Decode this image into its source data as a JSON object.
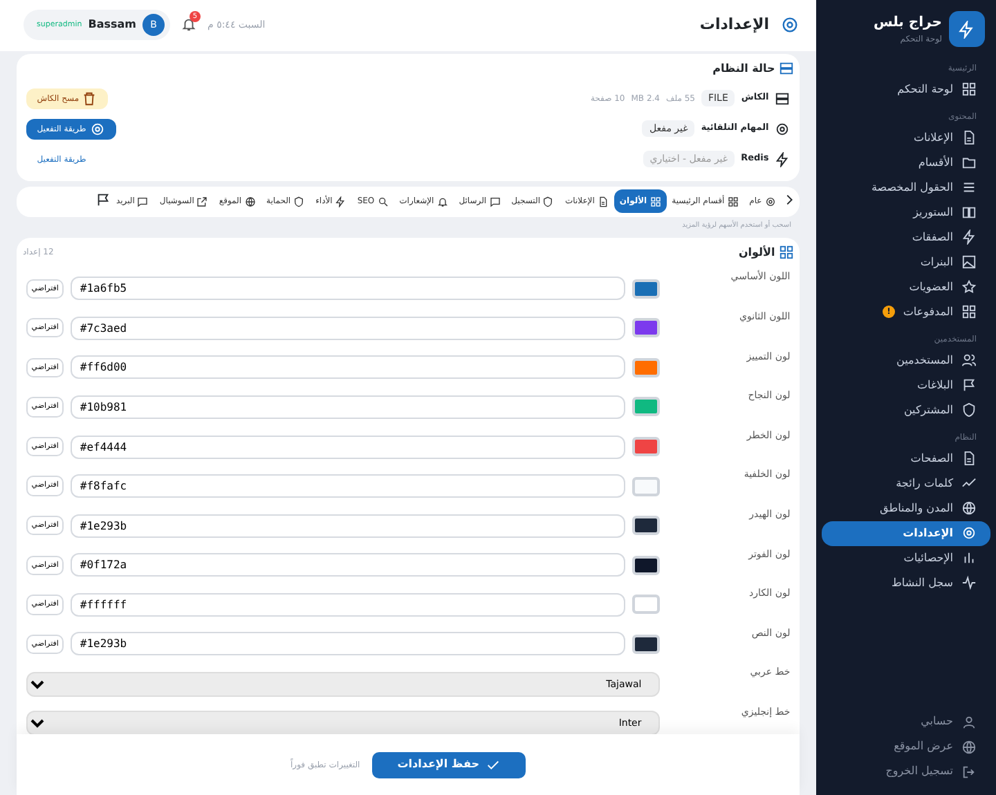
{
  "header": {
    "title": "الإعدادات",
    "datetime": "السبت ٥:٤٤ م",
    "notifications": "5",
    "user": {
      "initial": "B",
      "name": "Bassam",
      "role": "superadmin"
    }
  },
  "status": {
    "title": "حالة النظام",
    "rows": [
      {
        "kind": "cache",
        "label": "الكاش",
        "badge": "FILE",
        "stats": [
          "55 ملف",
          "2.4 MB",
          "10 صفحة"
        ],
        "action": {
          "kind": "warning",
          "label": "مسح الكاش"
        }
      },
      {
        "kind": "cron",
        "label": "المهام التلقائية",
        "badge": "غير مفعل",
        "stats": [],
        "action": {
          "kind": "primary",
          "label": "طريقة التفعيل"
        }
      },
      {
        "kind": "redis",
        "label": "Redis",
        "badge": "غير مفعل - اختياري",
        "stats": [],
        "action": {
          "kind": "link",
          "label": "طريقة التفعيل"
        }
      }
    ]
  },
  "tabs": [
    {
      "label": "عام",
      "selected": false
    },
    {
      "label": "أقسام الرئيسية",
      "selected": false
    },
    {
      "label": "الألوان",
      "selected": true
    },
    {
      "label": "الإعلانات",
      "selected": false
    },
    {
      "label": "التسجيل",
      "selected": false
    },
    {
      "label": "الرسائل",
      "selected": false
    },
    {
      "label": "الإشعارات",
      "selected": false
    },
    {
      "label": "SEO",
      "selected": false
    },
    {
      "label": "الأداء",
      "selected": false
    },
    {
      "label": "الحماية",
      "selected": false
    },
    {
      "label": "الموقع",
      "selected": false
    },
    {
      "label": "السوشيال",
      "selected": false
    },
    {
      "label": "البريد",
      "selected": false
    }
  ],
  "tabs_hint": "اسحب أو استخدم الأسهم لرؤية المزيد",
  "colors": {
    "title": "الألوان",
    "count": "12 إعداد",
    "fields": [
      {
        "kind": "color",
        "label": "اللون الأساسي",
        "value": "#1a6fb5",
        "reset": "افتراضي"
      },
      {
        "kind": "color",
        "label": "اللون الثانوي",
        "value": "#7c3aed",
        "reset": "افتراضي"
      },
      {
        "kind": "color",
        "label": "لون التمييز",
        "value": "#ff6d00",
        "reset": "افتراضي"
      },
      {
        "kind": "color",
        "label": "لون النجاح",
        "value": "#10b981",
        "reset": "افتراضي"
      },
      {
        "kind": "color",
        "label": "لون الخطر",
        "value": "#ef4444",
        "reset": "افتراضي"
      },
      {
        "kind": "color",
        "label": "لون الخلفية",
        "value": "#f8fafc",
        "reset": "افتراضي"
      },
      {
        "kind": "color",
        "label": "لون الهيدر",
        "value": "#1e293b",
        "reset": "افتراضي"
      },
      {
        "kind": "color",
        "label": "لون الفوتر",
        "value": "#0f172a",
        "reset": "افتراضي"
      },
      {
        "kind": "color",
        "label": "لون الكارد",
        "value": "#ffffff",
        "reset": "افتراضي"
      },
      {
        "kind": "color",
        "label": "لون النص",
        "value": "#1e293b",
        "reset": "افتراضي"
      },
      {
        "kind": "select",
        "label": "خط عربي",
        "value": "Tajawal"
      },
      {
        "kind": "select",
        "label": "خط إنجليزي",
        "value": "Inter"
      }
    ]
  },
  "footer": {
    "save": "حفظ الإعدادات",
    "note": "التغييرات تطبق فوراً"
  },
  "sidebar": {
    "brand": "حراج بلس",
    "subtitle": "لوحة التحكم",
    "sections": [
      {
        "title": "الرئيسية",
        "items": [
          {
            "label": "لوحة التحكم",
            "selected": false
          }
        ]
      },
      {
        "title": "المحتوى",
        "items": [
          {
            "label": "الإعلانات",
            "selected": false
          },
          {
            "label": "الأقسام",
            "selected": false
          },
          {
            "label": "الحقول المخصصة",
            "selected": false
          },
          {
            "label": "الستوريز",
            "selected": false
          },
          {
            "label": "الصفقات",
            "selected": false
          },
          {
            "label": "البنرات",
            "selected": false
          },
          {
            "label": "العضويات",
            "selected": false
          },
          {
            "label": "المدفوعات",
            "selected": false,
            "badge": "!"
          }
        ]
      },
      {
        "title": "المستخدمين",
        "items": [
          {
            "label": "المستخدمين",
            "selected": false
          },
          {
            "label": "البلاغات",
            "selected": false
          },
          {
            "label": "المشتركين",
            "selected": false
          }
        ]
      },
      {
        "title": "النظام",
        "items": [
          {
            "label": "الصفحات",
            "selected": false
          },
          {
            "label": "كلمات رائجة",
            "selected": false
          },
          {
            "label": "المدن والمناطق",
            "selected": false
          },
          {
            "label": "الإعدادات",
            "selected": true
          },
          {
            "label": "الإحصائيات",
            "selected": false
          },
          {
            "label": "سجل النشاط",
            "selected": false
          }
        ]
      }
    ],
    "bottom": [
      {
        "label": "حسابي"
      },
      {
        "label": "عرض الموقع"
      },
      {
        "label": "تسجيل الخروج"
      }
    ]
  }
}
